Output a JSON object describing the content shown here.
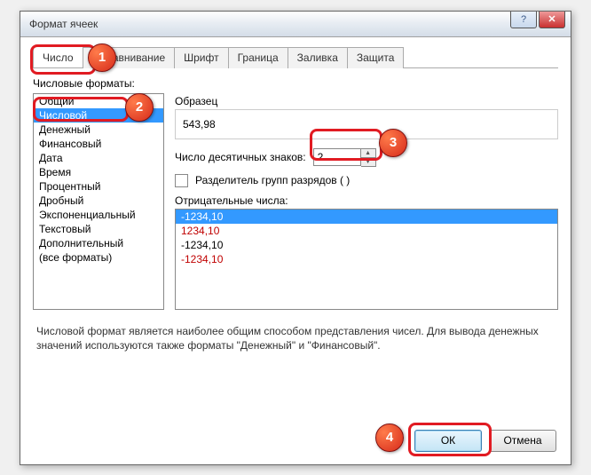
{
  "window": {
    "title": "Формат ячеек"
  },
  "tabs": [
    {
      "label": "Число",
      "active": true
    },
    {
      "label": "Выравнивание"
    },
    {
      "label": "Шрифт"
    },
    {
      "label": "Граница"
    },
    {
      "label": "Заливка"
    },
    {
      "label": "Защита"
    }
  ],
  "formats_label": "Числовые форматы:",
  "formats": [
    {
      "label": "Общий"
    },
    {
      "label": "Числовой",
      "selected": true
    },
    {
      "label": "Денежный"
    },
    {
      "label": "Финансовый"
    },
    {
      "label": "Дата"
    },
    {
      "label": "Время"
    },
    {
      "label": "Процентный"
    },
    {
      "label": "Дробный"
    },
    {
      "label": "Экспоненциальный"
    },
    {
      "label": "Текстовый"
    },
    {
      "label": "Дополнительный"
    },
    {
      "label": "(все форматы)"
    }
  ],
  "sample": {
    "label": "Образец",
    "value": "543,98"
  },
  "decimal": {
    "label": "Число десятичных знаков:",
    "value": "2"
  },
  "sep": {
    "label": "Разделитель групп разрядов ( )"
  },
  "neg_label": "Отрицательные числа:",
  "negatives": [
    {
      "text": "-1234,10",
      "selected": true,
      "color": "#fff"
    },
    {
      "text": "1234,10",
      "color": "#c00000"
    },
    {
      "text": "-1234,10",
      "color": "#000"
    },
    {
      "text": "-1234,10",
      "color": "#c00000"
    }
  ],
  "description": "Числовой формат является наиболее общим способом представления чисел. Для вывода денежных значений используются также форматы \"Денежный\" и \"Финансовый\".",
  "buttons": {
    "ok": "ОК",
    "cancel": "Отмена"
  },
  "badges": {
    "b1": "1",
    "b2": "2",
    "b3": "3",
    "b4": "4"
  }
}
